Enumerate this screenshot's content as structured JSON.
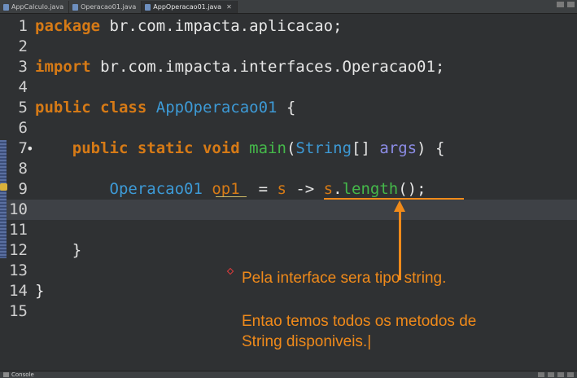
{
  "tabs": [
    {
      "label": "AppCalculo.java",
      "active": false
    },
    {
      "label": "Operacao01.java",
      "active": false
    },
    {
      "label": "AppOperacao01.java",
      "active": true
    }
  ],
  "code_lines": [
    {
      "n": "1",
      "tokens": [
        {
          "t": "package",
          "c": "kw"
        },
        {
          "t": " br.com.impacta.aplicacao;",
          "c": "op"
        }
      ]
    },
    {
      "n": "2",
      "tokens": []
    },
    {
      "n": "3",
      "tokens": [
        {
          "t": "import",
          "c": "kw"
        },
        {
          "t": " br.com.impacta.interfaces.Operacao01;",
          "c": "op"
        }
      ]
    },
    {
      "n": "4",
      "tokens": []
    },
    {
      "n": "5",
      "tokens": [
        {
          "t": "public",
          "c": "kw"
        },
        {
          "t": " ",
          "c": "op"
        },
        {
          "t": "class",
          "c": "kw"
        },
        {
          "t": " ",
          "c": "op"
        },
        {
          "t": "AppOperacao01",
          "c": "cls"
        },
        {
          "t": " {",
          "c": "op"
        }
      ]
    },
    {
      "n": "6",
      "tokens": []
    },
    {
      "n": "7",
      "fold": "•",
      "tokens": [
        {
          "t": "    ",
          "c": "op"
        },
        {
          "t": "public",
          "c": "kw"
        },
        {
          "t": " ",
          "c": "op"
        },
        {
          "t": "static",
          "c": "kw"
        },
        {
          "t": " ",
          "c": "op"
        },
        {
          "t": "void",
          "c": "kw"
        },
        {
          "t": " ",
          "c": "op"
        },
        {
          "t": "main",
          "c": "fn"
        },
        {
          "t": "(",
          "c": "op"
        },
        {
          "t": "String",
          "c": "cls"
        },
        {
          "t": "[] ",
          "c": "op"
        },
        {
          "t": "args",
          "c": "param"
        },
        {
          "t": ") {",
          "c": "op"
        }
      ]
    },
    {
      "n": "8",
      "tokens": []
    },
    {
      "n": "9",
      "tokens": [
        {
          "t": "        ",
          "c": "op"
        },
        {
          "t": "Operacao01",
          "c": "cls"
        },
        {
          "t": " ",
          "c": "op"
        },
        {
          "t": "op1",
          "c": "var"
        },
        {
          "t": "  = ",
          "c": "op"
        },
        {
          "t": "s",
          "c": "var"
        },
        {
          "t": " -> ",
          "c": "op"
        },
        {
          "t": "s",
          "c": "var"
        },
        {
          "t": ".",
          "c": "op"
        },
        {
          "t": "length",
          "c": "fn"
        },
        {
          "t": "();",
          "c": "op"
        }
      ]
    },
    {
      "n": "10",
      "current": true,
      "tokens": []
    },
    {
      "n": "11",
      "tokens": []
    },
    {
      "n": "12",
      "tokens": [
        {
          "t": "    }",
          "c": "op"
        }
      ]
    },
    {
      "n": "13",
      "tokens": []
    },
    {
      "n": "14",
      "tokens": [
        {
          "t": "}",
          "c": "op"
        }
      ]
    },
    {
      "n": "15",
      "tokens": []
    }
  ],
  "annotation": {
    "line1": "Pela interface sera tipo string.",
    "line2": "Entao temos todos os metodos de",
    "line3": "String disponiveis.|"
  },
  "console_tab": {
    "label": "Console"
  },
  "colors": {
    "background": "#2f3133",
    "keyword": "#d67a16",
    "class": "#3d9ad6",
    "method": "#45b84a",
    "annotation": "#f08a1a"
  }
}
